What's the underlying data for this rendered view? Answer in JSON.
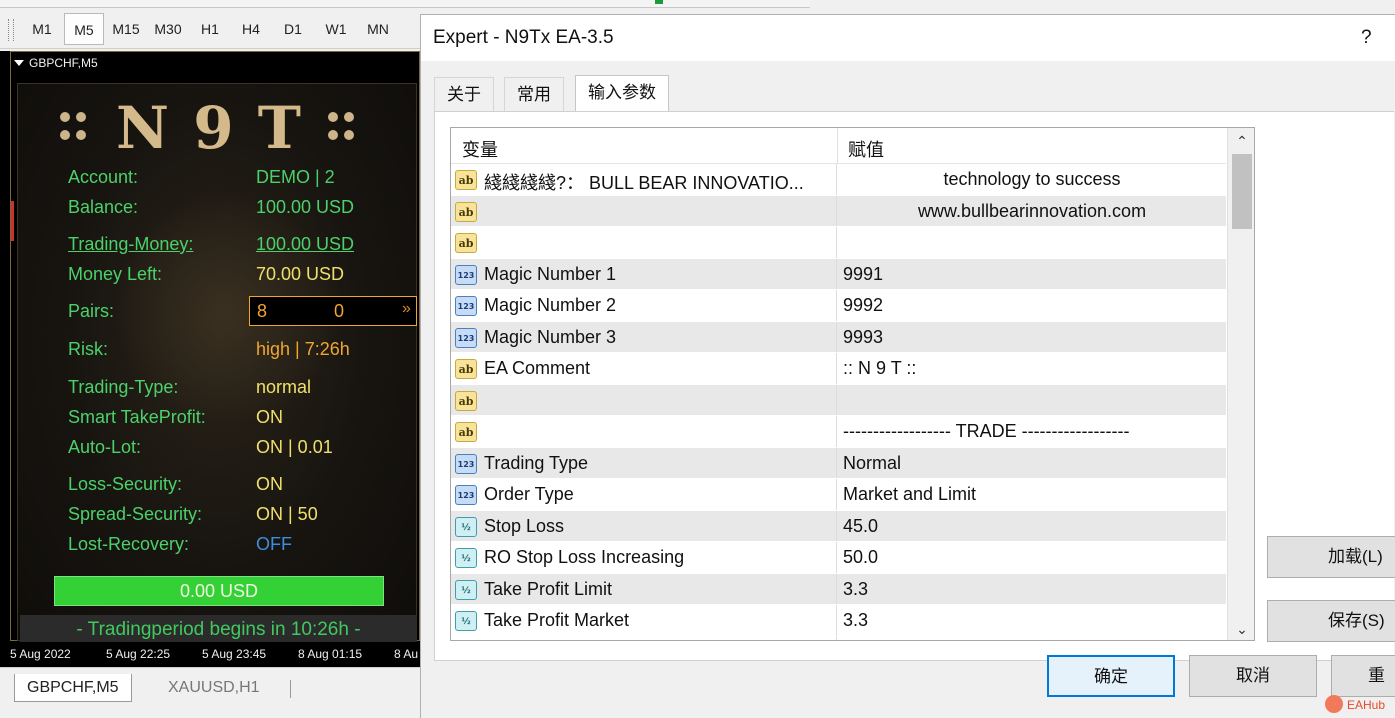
{
  "timeframes": {
    "items": [
      "M1",
      "M5",
      "M15",
      "M30",
      "H1",
      "H4",
      "D1",
      "W1",
      "MN"
    ],
    "active": "M5"
  },
  "chart": {
    "title": "GBPCHF,M5",
    "ea_panel": {
      "logo_text": "N 9 T",
      "account_label": "Account:",
      "account_value": "DEMO   |   2",
      "balance_label": "Balance:",
      "balance_value": "100.00 USD",
      "trading_money_label": "Trading-Money:",
      "trading_money_value": "100.00 USD",
      "money_left_label": "Money Left:",
      "money_left_value": "70.00 USD",
      "pairs_label": "Pairs:",
      "pairs_value_a": "8",
      "pairs_value_b": "0",
      "pairs_arrow": "»",
      "risk_label": "Risk:",
      "risk_value": "high   |   7:26h",
      "trading_type_label": "Trading-Type:",
      "trading_type_value": "normal",
      "smart_tp_label": "Smart TakeProfit:",
      "smart_tp_value": "ON",
      "auto_lot_label": "Auto-Lot:",
      "auto_lot_value": "ON    |    0.01",
      "loss_security_label": "Loss-Security:",
      "loss_security_value": "ON",
      "spread_security_label": "Spread-Security:",
      "spread_security_value": "ON    |    50",
      "lost_recovery_label": "Lost-Recovery:",
      "lost_recovery_value": "OFF",
      "usd_bar": "0.00 USD",
      "period_text": "- Tradingperiod begins in 10:26h -"
    },
    "time_axis": [
      "5 Aug 2022",
      "5 Aug 22:25",
      "5 Aug 23:45",
      "8 Aug 01:15",
      "8 Au"
    ]
  },
  "chart_tabs": [
    "GBPCHF,M5",
    "XAUUSD,H1"
  ],
  "dialog": {
    "title": "Expert - N9Tx EA-3.5",
    "help": "?",
    "tabs": [
      "关于",
      "常用",
      "输入参数"
    ],
    "grid": {
      "col_variable": "变量",
      "col_value": "赋值",
      "rows": [
        {
          "icon": "ab",
          "name": "綫綫綫綫?：  BULL BEAR INNOVATIO...",
          "value": "technology to success",
          "center": true
        },
        {
          "icon": "ab",
          "name": "",
          "value": "www.bullbearinnovation.com",
          "center": true
        },
        {
          "icon": "ab",
          "name": "",
          "value": "",
          "center": false
        },
        {
          "icon": "123",
          "name": "Magic Number 1",
          "value": "9991",
          "center": false
        },
        {
          "icon": "123",
          "name": "Magic Number 2",
          "value": "9992",
          "center": false
        },
        {
          "icon": "123",
          "name": "Magic Number 3",
          "value": "9993",
          "center": false
        },
        {
          "icon": "ab",
          "name": "EA Comment",
          "value": ":: N 9 T ::",
          "center": false
        },
        {
          "icon": "ab",
          "name": "",
          "value": "",
          "center": false
        },
        {
          "icon": "ab",
          "name": "",
          "value": "------------------ TRADE ------------------",
          "center": false
        },
        {
          "icon": "123",
          "name": "Trading Type",
          "value": "Normal",
          "center": false
        },
        {
          "icon": "123",
          "name": "Order Type",
          "value": "Market and Limit",
          "center": false
        },
        {
          "icon": "half",
          "name": "Stop Loss",
          "value": "45.0",
          "center": false
        },
        {
          "icon": "half",
          "name": "RO Stop Loss Increasing",
          "value": "50.0",
          "center": false
        },
        {
          "icon": "half",
          "name": "Take Profit Limit",
          "value": "3.3",
          "center": false
        },
        {
          "icon": "half",
          "name": "Take Profit Market",
          "value": "3.3",
          "center": false
        }
      ]
    },
    "icon_labels": {
      "ab": "ab",
      "123": "123",
      "half": "½"
    },
    "buttons": {
      "load": "加载(L)",
      "save": "保存(S)",
      "ok": "确定",
      "cancel": "取消",
      "reset": "重"
    },
    "watermark": "EAHub"
  }
}
